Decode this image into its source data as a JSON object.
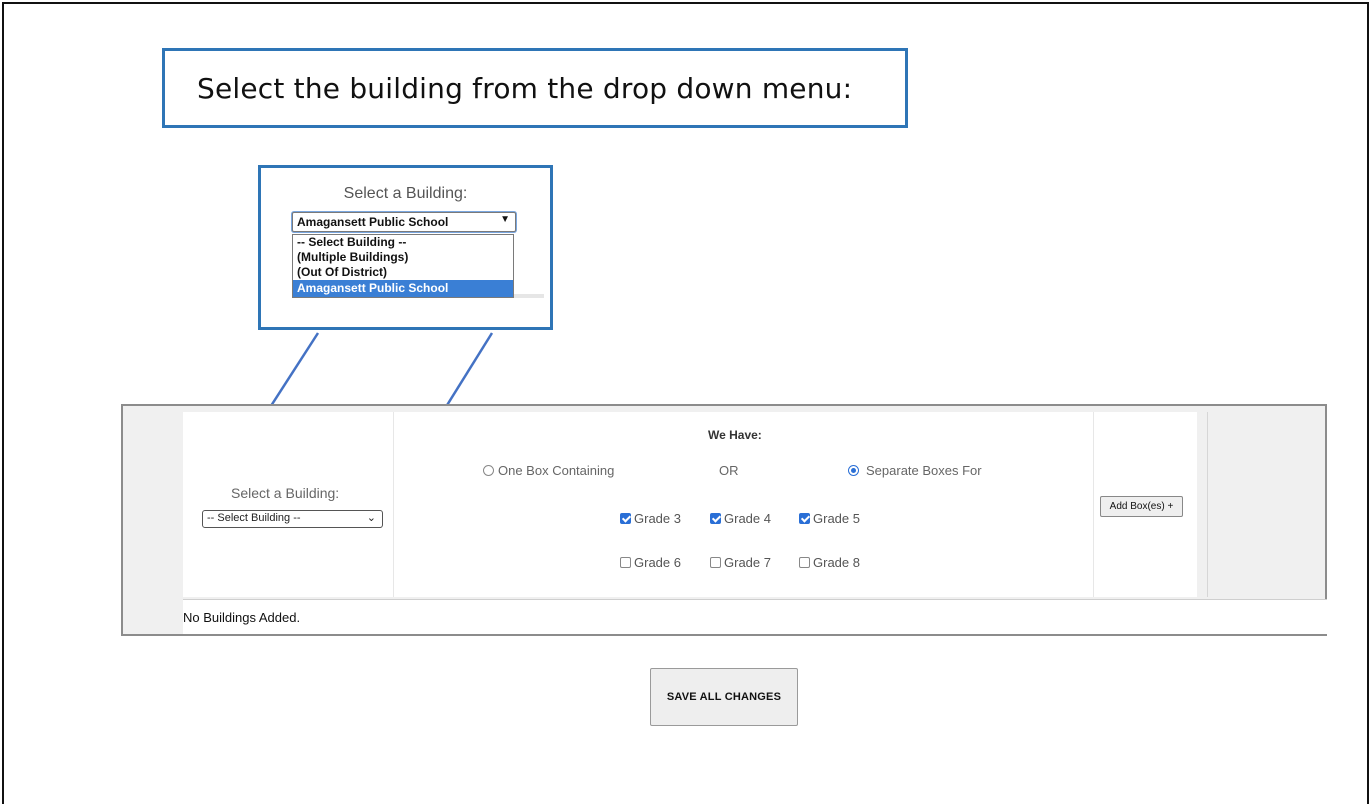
{
  "callout": {
    "title": "Select the building from the drop down menu:"
  },
  "zoom": {
    "label": "Select a Building:",
    "selected_value": "Amagansett Public School",
    "arrow_icon": "▼",
    "options": [
      "-- Select Building --",
      "(Multiple Buildings)",
      "(Out Of District)",
      "Amagansett Public School"
    ],
    "highlighted_index": 3
  },
  "form": {
    "building_label": "Select a Building:",
    "building_select_value": "-- Select Building --",
    "we_have_label": "We Have:",
    "radio_one_box": "One Box Containing",
    "or_label": "OR",
    "radio_separate": "Separate Boxes For",
    "separate_selected": true,
    "grades_row1": [
      {
        "label": "Grade 3",
        "checked": true
      },
      {
        "label": "Grade 4",
        "checked": true
      },
      {
        "label": "Grade 5",
        "checked": true
      }
    ],
    "grades_row2": [
      {
        "label": "Grade 6",
        "checked": false
      },
      {
        "label": "Grade 7",
        "checked": false
      },
      {
        "label": "Grade 8",
        "checked": false
      }
    ],
    "add_button": "Add Box(es) +",
    "footer_text": "No Buildings Added."
  },
  "save_button": "SAVE ALL CHANGES",
  "colors": {
    "callout_border": "#2e75b6",
    "highlight": "#3a7fd5",
    "checkbox": "#2a6fd6"
  }
}
